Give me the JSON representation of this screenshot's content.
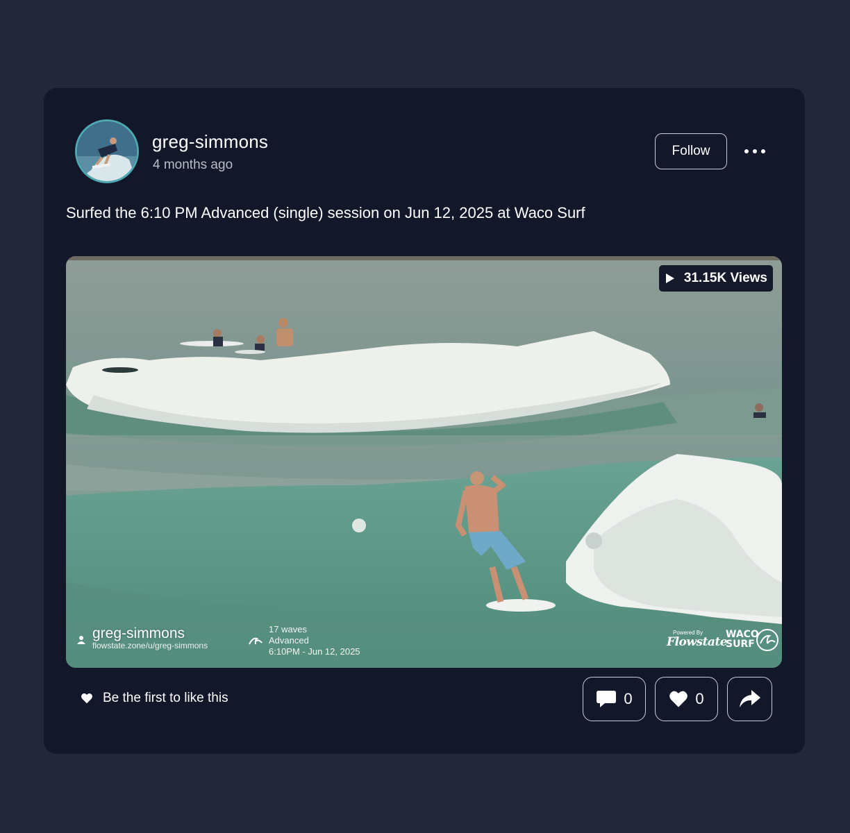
{
  "post": {
    "username": "greg-simmons",
    "timestamp": "4 months ago",
    "follow_label": "Follow",
    "more_icon": "more-horizontal-icon",
    "caption": "Surfed the 6:10 PM Advanced (single) session on Jun 12, 2025 at Waco Surf"
  },
  "video": {
    "views": "31.15K Views",
    "overlay": {
      "username": "greg-simmons",
      "profile_url": "flowstate.zone/u/greg-simmons",
      "waves": "17 waves",
      "level": "Advanced",
      "session_time": "6:10PM - Jun 12, 2025",
      "powered_by": "Powered By",
      "flowstate": "Flowstate",
      "waco_line1": "WACO",
      "waco_line2": "SURF"
    }
  },
  "footer": {
    "likes_text": "Be the first to like this",
    "comment_count": "0",
    "like_count": "0"
  },
  "colors": {
    "page_bg": "#22273a",
    "card_bg": "#12172a",
    "avatar_ring": "#4fa9b3",
    "button_border": "#c8ccd6"
  }
}
